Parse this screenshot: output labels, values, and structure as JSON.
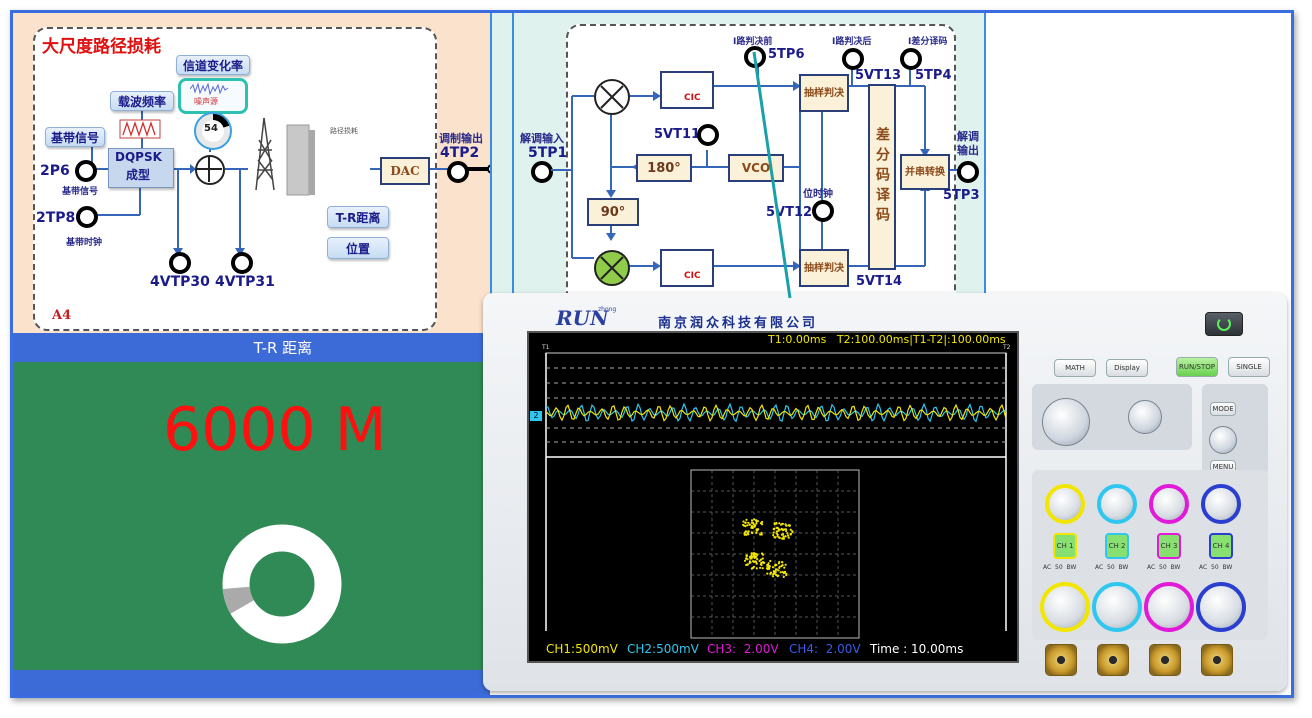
{
  "left_panel": {
    "title": "大尺度路径损耗",
    "corner_label": "A4",
    "buttons": {
      "channel_rate": "信道变化率",
      "carrier_freq": "载波频率",
      "baseband": "基带信号",
      "tr_distance": "T-R距离",
      "position": "位置"
    },
    "noise_label": "噪声源",
    "dial_value": "54",
    "modulator_line1": "DQPSK",
    "modulator_line2": "成型",
    "dac_label": "DAC",
    "path_loss_small": "路径损耗",
    "points": {
      "p2p6": "2P6",
      "p2p6_sub": "基带信号",
      "p2tp8": "2TP8",
      "p2tp8_sub": "基带时钟",
      "p4vtp30": "4VTP30",
      "p4vtp31": "4VTP31",
      "p4tp2_title": "调制输出",
      "p4tp2": "4TP2"
    }
  },
  "right_panel": {
    "demod_in_title": "解调输入",
    "p5tp1": "5TP1",
    "pre_decision": "I路判决前",
    "p5tp6": "5TP6",
    "post_decision": "I路判决后",
    "p5vt13": "5VT13",
    "diff_decode": "I差分译码",
    "p5tp4": "5TP4",
    "cic": "CIC",
    "sample_decide": "抽样判决",
    "p5vt11": "5VT11",
    "phase180": "180°",
    "vco": "VCO",
    "phase90": "90°",
    "bit_clock": "位时钟",
    "p5vt12": "5VT12",
    "diff_decoder_block": "差分码译码",
    "par_ser": "并串转换",
    "demod_out_title": "解调输出",
    "p5tp3": "5TP3",
    "p5vt14": "5VT14"
  },
  "distance": {
    "header": "T-R 距离",
    "value": "6000 M",
    "donut_fraction": 0.07
  },
  "oscilloscope": {
    "brand": "RUN",
    "brand_small": "zhong",
    "company": "南京润众科技有限公司",
    "cursor_readout": "T1:0.00ms   T2:100.00ms|T1-T2|:100.00ms",
    "t1": "T1",
    "t2": "T2",
    "ch_marker": "2",
    "ch1": "CH1:500mV",
    "ch2": "CH2:500mV",
    "ch3": "CH3:  2.00V",
    "ch4": "CH4:  2.00V",
    "time": "Time : 10.00ms",
    "buttons": {
      "math": "MATH",
      "display": "Display",
      "run_stop": "RUN/STOP",
      "single": "SINGLE",
      "mode": "MODE",
      "menu": "MENU"
    },
    "channel_labels": [
      "CH 1",
      "CH 2",
      "CH 3",
      "CH 4"
    ],
    "coupling": "AC  50  BW",
    "colors": {
      "ch1": "#f2e600",
      "ch2": "#2fc7f0",
      "ch3": "#e01ad8",
      "ch4": "#2a3fd0"
    }
  }
}
